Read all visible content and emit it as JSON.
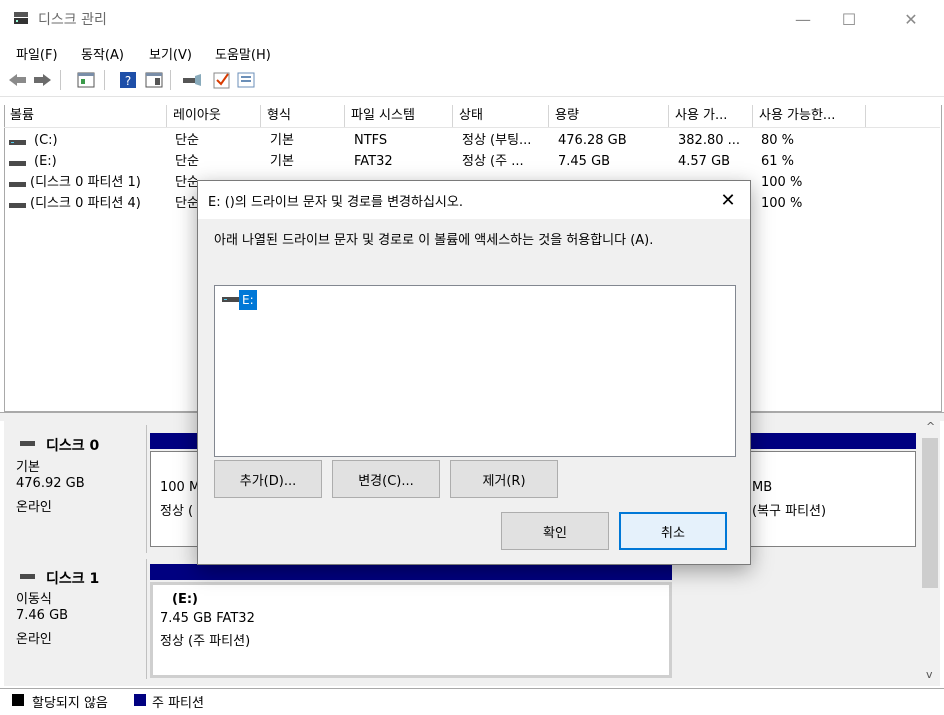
{
  "window": {
    "title": "디스크 관리",
    "min": "—",
    "max": "☐",
    "close": "✕"
  },
  "menu": [
    "파일(F)",
    "동작(A)",
    "보기(V)",
    "도움말(H)"
  ],
  "columns": [
    "볼륨",
    "레이아웃",
    "형식",
    "파일 시스템",
    "상태",
    "용량",
    "사용 가...",
    "사용 가능한..."
  ],
  "volumes": [
    {
      "name": "(C:)",
      "layout": "단순",
      "type": "기본",
      "fs": "NTFS",
      "status": "정상 (부팅...",
      "capacity": "476.28 GB",
      "free": "382.80 ...",
      "pct": "80 %"
    },
    {
      "name": "(E:)",
      "layout": "단순",
      "type": "기본",
      "fs": "FAT32",
      "status": "정상 (주 ...",
      "capacity": "7.45 GB",
      "free": "4.57 GB",
      "pct": "61 %"
    },
    {
      "name": "(디스크 0 파티션 1)",
      "layout": "단순",
      "type": "",
      "fs": "",
      "status": "",
      "capacity": "",
      "free": "",
      "pct": "100 %"
    },
    {
      "name": "(디스크 0 파티션 4)",
      "layout": "단순",
      "type": "",
      "fs": "",
      "status": "",
      "capacity": "",
      "free": "",
      "pct": "100 %"
    }
  ],
  "disks": [
    {
      "title": "디스크 0",
      "kind": "기본",
      "size": "476.92 GB",
      "state": "온라인",
      "left_part": {
        "line1": "100 M",
        "line2": "정상 ("
      },
      "right_part": {
        "line1": "MB",
        "line2": "(복구 파티션)"
      }
    },
    {
      "title": "디스크 1",
      "kind": "이동식",
      "size": "7.46 GB",
      "state": "온라인",
      "part": {
        "label": "(E:)",
        "line1": "7.45 GB FAT32",
        "line2": "정상 (주 파티션)"
      }
    }
  ],
  "legend": {
    "unallocated": "할당되지 않음",
    "primary": "주 파티션"
  },
  "dialog": {
    "title": "E: ()의 드라이브 문자 및 경로를 변경하십시오.",
    "close": "✕",
    "description": "아래 나열된 드라이브 문자 및 경로로 이 볼륨에 액세스하는 것을 허용합니다 (A).",
    "list_item": "E:",
    "add": "추가(D)...",
    "change": "변경(C)...",
    "remove": "제거(R)",
    "ok": "확인",
    "cancel": "취소"
  },
  "colors": {
    "accent": "#0078d7",
    "partition_head": "#000080"
  },
  "scrollbar": {
    "up": "^",
    "down": "v"
  }
}
